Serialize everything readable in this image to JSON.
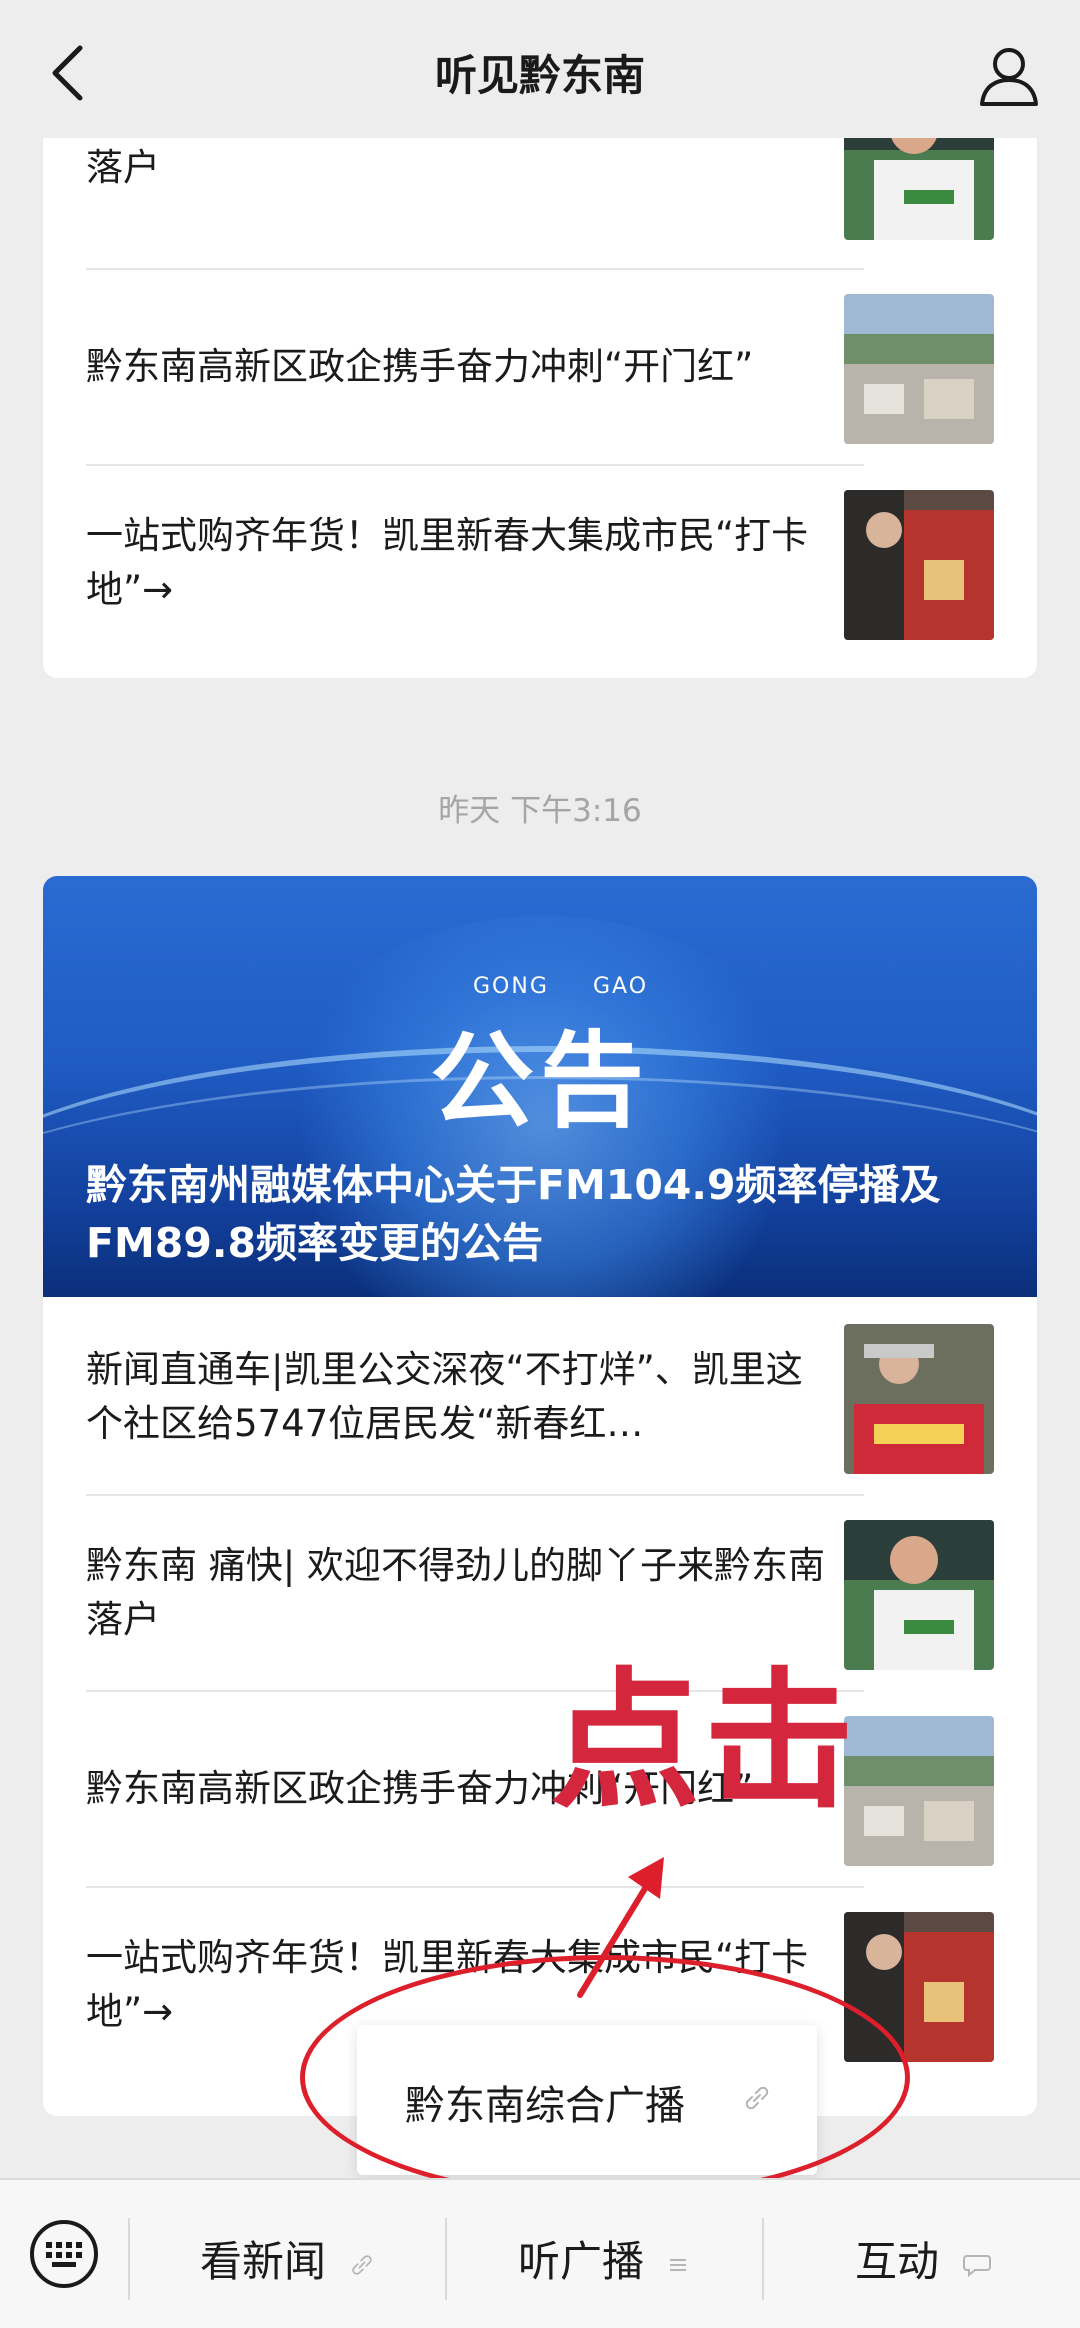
{
  "header": {
    "title": "听见黔东南"
  },
  "feed_top": [
    "黔东南 痛快| 欢迎不得劲儿的脚丫子来黔东南落户",
    "黔东南高新区政企携手奋力冲刺“开门红”",
    "一站式购齐年货！凯里新春大集成市民“打卡地”→"
  ],
  "timestamp": "昨天 下午3:16",
  "banner": {
    "pinyin_left": "GONG",
    "pinyin_right": "GAO",
    "heading": "公告",
    "title": "黔东南州融媒体中心关于FM104.9频率停播及FM89.8频率变更的公告"
  },
  "feed_bottom": [
    "新闻直通车|凯里公交深夜“不打烊”、凯里这个社区给5747位居民发“新春红…",
    "黔东南 痛快| 欢迎不得劲儿的脚丫子来黔东南落户",
    "黔东南高新区政企携手奋力冲刺“开门红”",
    "一站式购齐年货！凯里新春大集成市民“打卡地”→"
  ],
  "annotation": {
    "click_label": "点击"
  },
  "popup_menu": {
    "item": "黔东南综合广播"
  },
  "bottom_menu": {
    "tab1": "看新闻",
    "tab2": "听广播",
    "tab3": "互动"
  },
  "colors": {
    "annotation_red": "#dd1f2c",
    "banner_blue": "#1f5bc3"
  }
}
